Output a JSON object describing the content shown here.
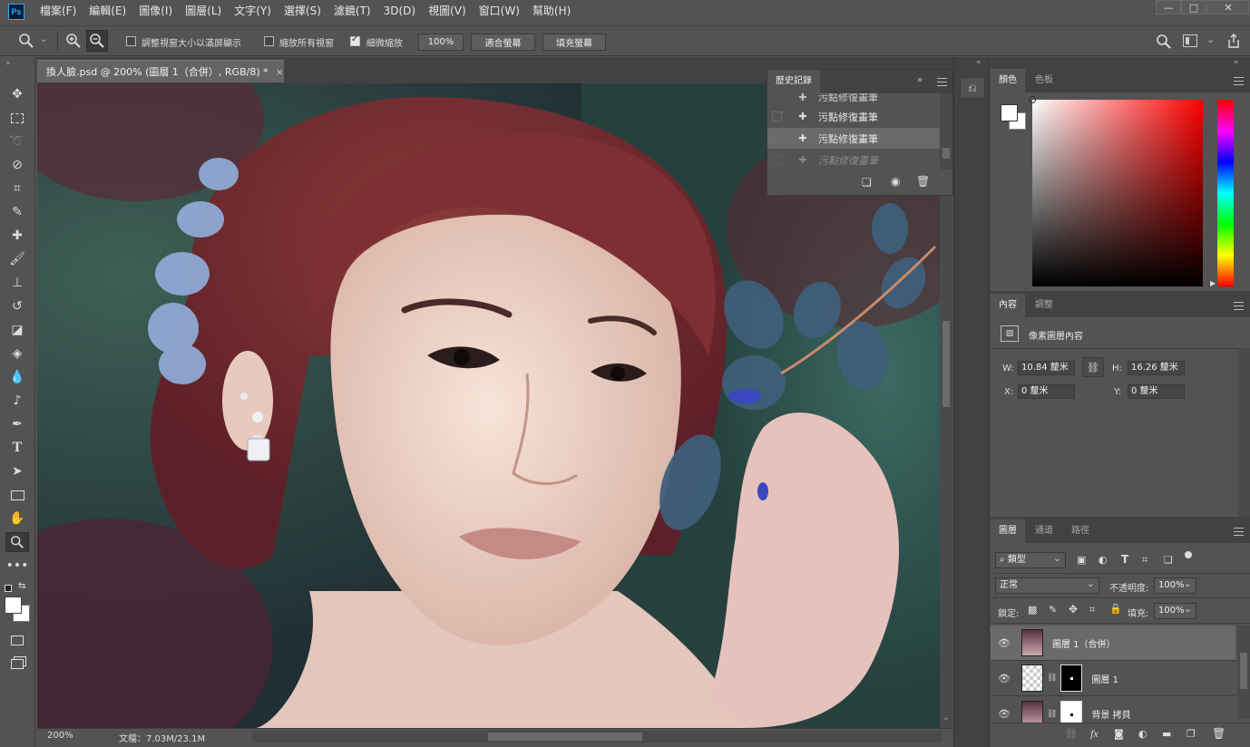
{
  "app": {
    "logo": "Ps"
  },
  "menu": [
    "檔案(F)",
    "編輯(E)",
    "圖像(I)",
    "圖層(L)",
    "文字(Y)",
    "選擇(S)",
    "濾鏡(T)",
    "3D(D)",
    "視圖(V)",
    "窗口(W)",
    "幫助(H)"
  ],
  "window_controls": {
    "minimize": "—",
    "maximize": "□",
    "close": "✕"
  },
  "options": {
    "resize_window_label": "調整視窗大小以滿屏顯示",
    "resize_window_checked": false,
    "zoom_all_label": "縮放所有視窗",
    "zoom_all_checked": false,
    "scrubby_label": "細微縮放",
    "scrubby_checked": true,
    "zoom_value": "100%",
    "fit_screen_label": "適合螢幕",
    "fill_screen_label": "填充螢幕"
  },
  "document": {
    "tab_title": "換人臉.psd @ 200% (圖層 1（合併）, RGB/8) *",
    "close": "×"
  },
  "status": {
    "zoom": "200%",
    "doc_info": "文檔：7.03M/23.1M"
  },
  "history": {
    "tab": "歷史記錄",
    "items": [
      {
        "label": "污點修復畫筆",
        "state": "partial"
      },
      {
        "label": "污點修復畫筆",
        "state": "normal"
      },
      {
        "label": "污點修復畫筆",
        "state": "selected"
      },
      {
        "label": "污點修復畫筆",
        "state": "undone"
      }
    ]
  },
  "color_panel": {
    "tabs": [
      "顏色",
      "色板"
    ],
    "foreground": "#ffffff",
    "background": "#ffffff",
    "hue": "#ff0000"
  },
  "properties": {
    "tabs": [
      "內容",
      "調整"
    ],
    "type_label": "像素圖層內容",
    "w_label": "W:",
    "w_value": "10.84 釐米",
    "h_label": "H:",
    "h_value": "16.26 釐米",
    "x_label": "X:",
    "x_value": "0 釐米",
    "y_label": "Y:",
    "y_value": "0 釐米"
  },
  "layers": {
    "tabs": [
      "圖層",
      "通道",
      "路徑"
    ],
    "filter_label": "類型",
    "blend_mode": "正常",
    "opacity_label": "不透明度:",
    "opacity_value": "100%",
    "lock_label": "鎖定:",
    "fill_label": "填充:",
    "fill_value": "100%",
    "items": [
      {
        "name": "圖層 1（合併）",
        "selected": true,
        "mask": false
      },
      {
        "name": "圖層 1",
        "selected": false,
        "mask": true
      },
      {
        "name": "背景 拷貝",
        "selected": false,
        "mask": true
      }
    ],
    "footer_icons": [
      "link-icon",
      "fx-icon",
      "mask-icon",
      "adjustment-icon",
      "folder-icon",
      "new-layer-icon",
      "trash-icon"
    ]
  }
}
